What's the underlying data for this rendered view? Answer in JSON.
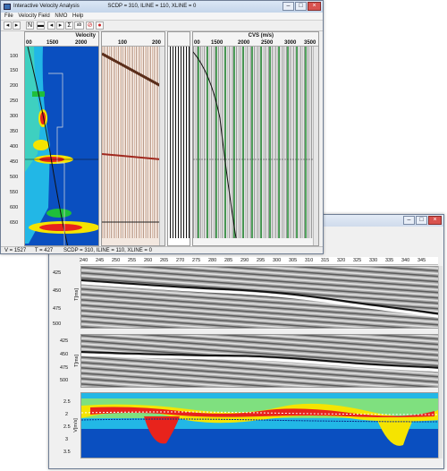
{
  "window1": {
    "title": "Interactive Velocity Analysis",
    "title_info": "SCDP = 310,  ILINE = 110,  XLINE = 0",
    "menu": [
      "File",
      "Velocity Field",
      "NMO",
      "Help"
    ],
    "toolbar_text_box": "ab",
    "velocity_panel": {
      "title": "Velocity",
      "ticks": [
        "00",
        "1500",
        "2000"
      ],
      "time_ticks": [
        "100",
        "150",
        "200",
        "250",
        "300",
        "350",
        "400",
        "450",
        "500",
        "550",
        "600",
        "650"
      ]
    },
    "gather_panel": {
      "ticks": [
        "100",
        "200"
      ]
    },
    "cvs_panel": {
      "title": "CVS (m/s)",
      "ticks": [
        "00",
        "1500",
        "2000",
        "2500",
        "3000",
        "3500",
        "35"
      ]
    },
    "status": {
      "v": "V = 1527",
      "t": "T = 427",
      "loc": "SCDP = 310,  ILINE = 110,  XLINE = 0"
    }
  },
  "window2": {
    "cdp_ticks": [
      "240",
      "245",
      "250",
      "255",
      "260",
      "265",
      "270",
      "275",
      "280",
      "285",
      "290",
      "295",
      "300",
      "305",
      "310",
      "315",
      "320",
      "325",
      "330",
      "335",
      "340",
      "345"
    ],
    "panel_a": {
      "ylabel": "T[ms]",
      "ticks": [
        "425",
        "450",
        "475",
        "500"
      ]
    },
    "panel_b": {
      "ylabel": "T[ms]",
      "ticks": [
        "425",
        "450",
        "475",
        "500"
      ]
    },
    "panel_c": {
      "ylabel": "V[m/s]",
      "ticks": [
        "2.5",
        "2",
        "2.5",
        "3",
        "3.5"
      ]
    }
  },
  "colors": {
    "semblance_blue": "#0a4fc0",
    "semblance_cyan": "#22b7e6",
    "semblance_yellow": "#f5e400",
    "semblance_red": "#e8231c",
    "cvs_green": "#1a8a2a"
  }
}
